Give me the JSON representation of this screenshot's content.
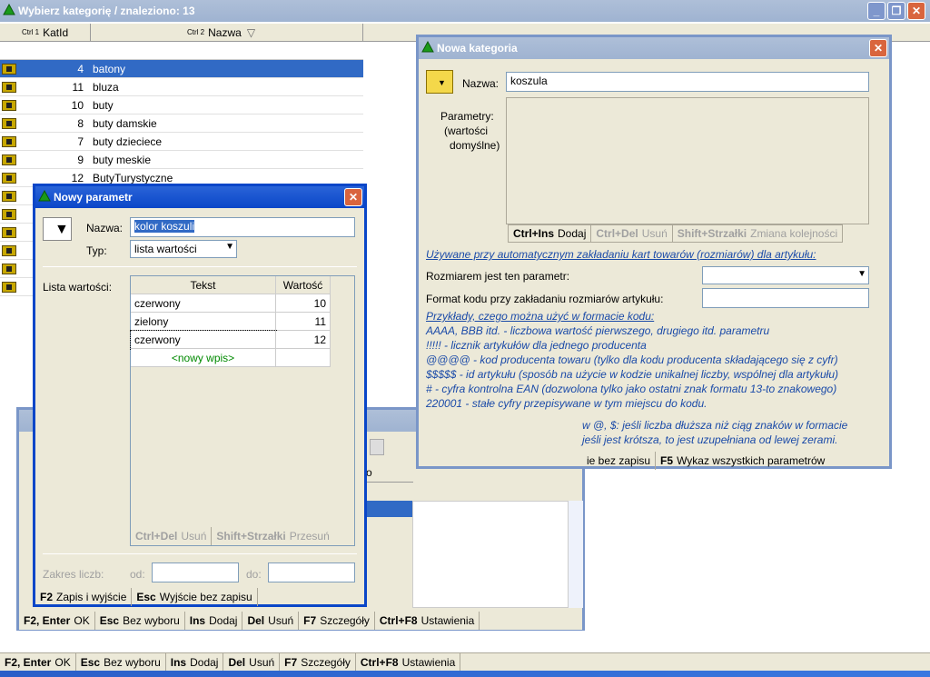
{
  "main": {
    "title": "Wybierz kategorię / znaleziono: 13",
    "col_ctrl1": "Ctrl 1",
    "col_id": "KatId",
    "col_ctrl2": "Ctrl 2",
    "col_name": "Nazwa",
    "rows": [
      {
        "id": "4",
        "name": "batony"
      },
      {
        "id": "11",
        "name": "bluza"
      },
      {
        "id": "10",
        "name": "buty"
      },
      {
        "id": "8",
        "name": "buty damskie"
      },
      {
        "id": "7",
        "name": "buty dzieciece"
      },
      {
        "id": "9",
        "name": "buty meskie"
      },
      {
        "id": "12",
        "name": "ButyTurystyczne"
      }
    ],
    "footer": [
      {
        "key": "F2, Enter",
        "label": "OK"
      },
      {
        "key": "Esc",
        "label": "Bez wyboru"
      },
      {
        "key": "Ins",
        "label": "Dodaj"
      },
      {
        "key": "Del",
        "label": "Usuń"
      },
      {
        "key": "F7",
        "label": "Szczegóły"
      },
      {
        "key": "Ctrl+F8",
        "label": "Ustawienia"
      }
    ]
  },
  "nowa": {
    "title": "Nowa kategoria",
    "name_label": "Nazwa:",
    "name_value": "koszula",
    "params_label1": "Parametry:",
    "params_label2": "(wartości",
    "params_label3": "domyślne)",
    "btn_add_key": "Ctrl+Ins",
    "btn_add": "Dodaj",
    "btn_del_key": "Ctrl+Del",
    "btn_del": "Usuń",
    "btn_order_key": "Shift+Strzałki",
    "btn_order": "Zmiana kolejności",
    "auto_note": "Używane przy automatycznym zakładaniu kart towarów (rozmiarów) dla artykułu:",
    "size_param_label": "Rozmiarem jest ten parametr:",
    "code_format_label": "Format kodu przy zakładaniu rozmiarów artykułu:",
    "examples_title": "Przykłady, czego można użyć w formacie kodu:",
    "ex1": "AAAA, BBB itd. - liczbowa wartość pierwszego, drugiego itd. parametru",
    "ex2": "!!!!! - licznik artykułów dla jednego producenta",
    "ex3": "@@@@ - kod producenta towaru (tylko dla kodu producenta składającego się z cyfr)",
    "ex4": "$$$$$ - id artykułu (sposób na użycie w kodzie unikalnej liczby, wspólnej dla artykułu)",
    "ex5": "# - cyfra kontrolna EAN (dozwolona tylko jako ostatni znak formatu 13-to znakowego)",
    "ex6": "220001 - stałe cyfry przepisywane w tym miejscu do kodu.",
    "ex7": "w @, $: jeśli liczba dłuższa niż ciąg znaków w formacie",
    "ex8": "jeśli jest krótsza, to jest uzupełniana od lewej zerami.",
    "bottom_partial": "ie bez zapisu",
    "f5_key": "F5",
    "f5_label": "Wykaz wszystkich parametrów"
  },
  "param": {
    "title": "Nowy parametr",
    "name_label": "Nazwa:",
    "name_value": "kolor koszuli",
    "type_label": "Typ:",
    "type_value": "lista wartości",
    "list_label": "Lista wartości:",
    "col_text": "Tekst",
    "col_value": "Wartość",
    "items": [
      {
        "text": "czerwony",
        "value": "10"
      },
      {
        "text": "zielony",
        "value": "11"
      },
      {
        "text": "czerwony",
        "value": "12"
      }
    ],
    "new_entry": "<nowy wpis>",
    "del_key": "Ctrl+Del",
    "del_label": "Usuń",
    "move_key": "Shift+Strzałki",
    "move_label": "Przesuń",
    "range_label": "Zakres liczb:",
    "from_label": "od:",
    "to_label": "do:",
    "f2_key": "F2",
    "f2_label": "Zapis i wyjście",
    "esc_key": "Esc",
    "esc_label": "Wyjście bez zapisu"
  },
  "back": {
    "partial_header": "o",
    "footer": [
      {
        "key": "F2, Enter",
        "label": "OK"
      },
      {
        "key": "Esc",
        "label": "Bez wyboru"
      },
      {
        "key": "Ins",
        "label": "Dodaj"
      },
      {
        "key": "Del",
        "label": "Usuń"
      },
      {
        "key": "F7",
        "label": "Szczegóły"
      },
      {
        "key": "Ctrl+F8",
        "label": "Ustawienia"
      }
    ]
  }
}
